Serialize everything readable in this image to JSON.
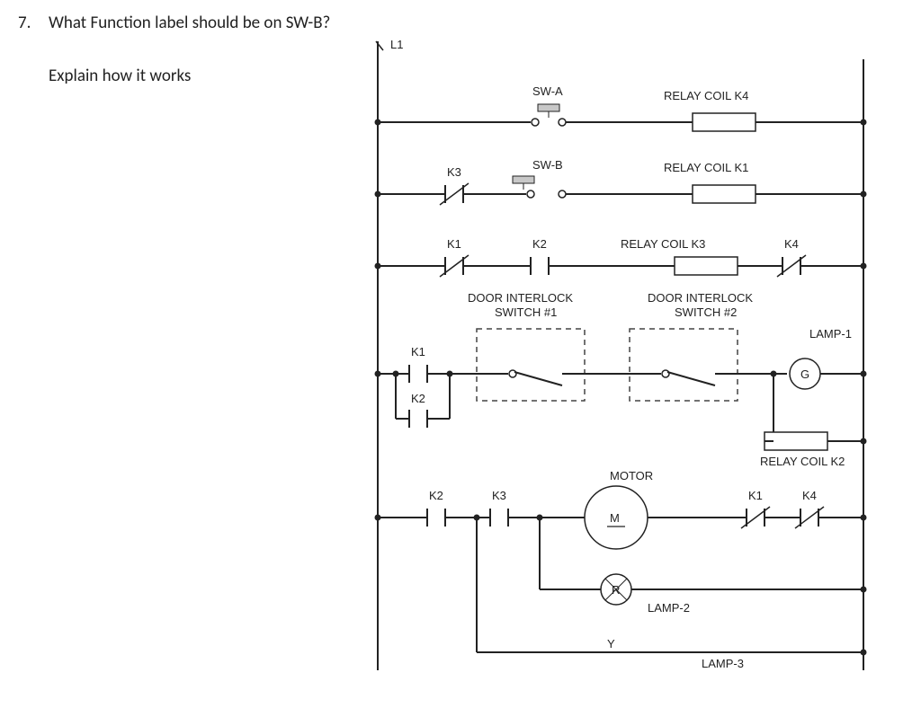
{
  "question": {
    "number": "7.",
    "text": "What Function label should be on SW-B?",
    "sub": "Explain how it works"
  },
  "labels": {
    "L1": "L1",
    "SW_A": "SW-A",
    "SW_B": "SW-B",
    "RELAY_K4": "RELAY COIL K4",
    "RELAY_K1": "RELAY COIL K1",
    "RELAY_K3": "RELAY COIL K3",
    "RELAY_K2": "RELAY COIL K2",
    "K1": "K1",
    "K2": "K2",
    "K3": "K3",
    "K4": "K4",
    "DOOR1_L1": "DOOR INTERLOCK",
    "DOOR1_L2": "SWITCH #1",
    "DOOR2_L1": "DOOR INTERLOCK",
    "DOOR2_L2": "SWITCH #2",
    "LAMP1": "LAMP-1",
    "LAMP2": "LAMP-2",
    "LAMP3": "LAMP-3",
    "MOTOR": "MOTOR",
    "M": "M",
    "R": "R",
    "G": "G",
    "Y": "Y"
  }
}
